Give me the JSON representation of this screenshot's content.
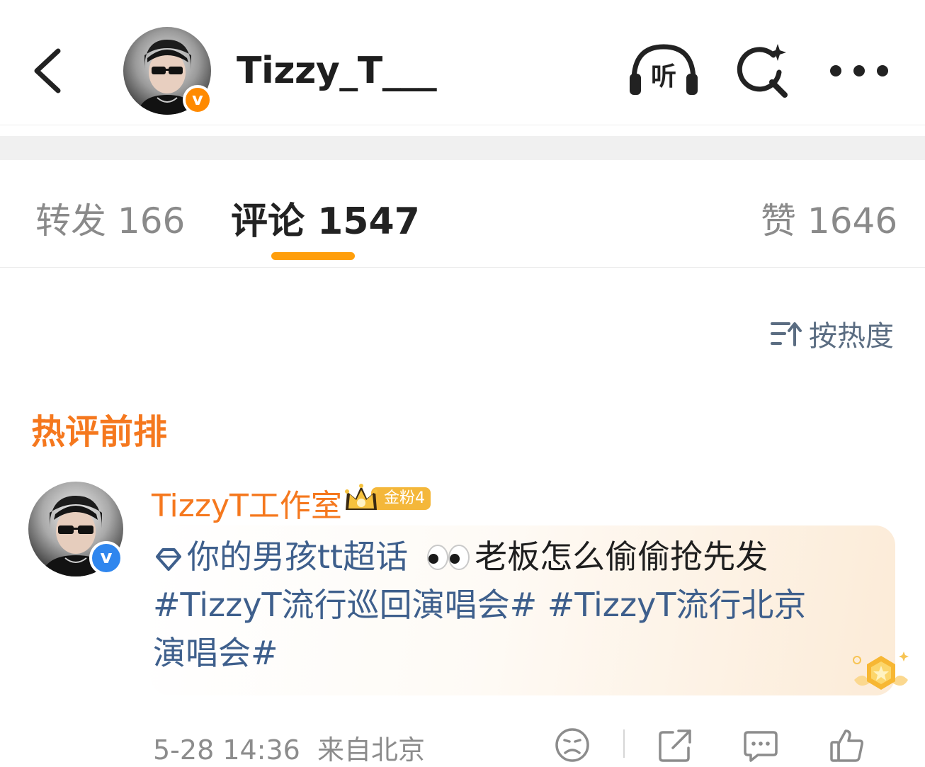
{
  "header": {
    "username": "Tizzy_T___",
    "avatar_icon": "user-avatar",
    "verified_icon": "orange-verified-v",
    "verified_glyph": "v",
    "listen_glyph": "听",
    "icons": {
      "back": "chevron-left-icon",
      "listen": "headphones-listen-icon",
      "search": "sparkle-search-icon",
      "more": "more-dots-icon"
    }
  },
  "tabs": {
    "repost": "转发 166",
    "comments": "评论 1547",
    "likes": "赞 1646",
    "active": "comments",
    "indicator_color": "#ff9e0b"
  },
  "sort": {
    "label": "按热度",
    "icon": "sort-order-icon"
  },
  "section_heading": "热评前排",
  "comment": {
    "username": "TizzyT工作室",
    "badge": {
      "label": "金粉4",
      "icon": "crown-icon"
    },
    "verified_glyph": "v",
    "body": {
      "supertopic": "你的男孩tt超话",
      "eyes_icon": "eyes-emoji",
      "text": "老板怎么偷偷抢先发",
      "hashtag1": "#TizzyT流行巡回演唱会#",
      "hashtag2_line1": "#TizzyT流行北京",
      "hashtag2_line2": "演唱会#"
    },
    "time": "5-28 14:36",
    "location": "来自北京",
    "medal_icon": "star-medal-icon",
    "action_icons": {
      "dislike": "sad-face-icon",
      "share": "share-icon",
      "reply": "comment-bubble-icon",
      "like": "thumb-up-icon"
    }
  },
  "colors": {
    "accent_orange": "#f5781e",
    "link_blue": "#3e5f8c",
    "verified_blue": "#2f86ee",
    "verified_orange": "#ff8a00"
  }
}
